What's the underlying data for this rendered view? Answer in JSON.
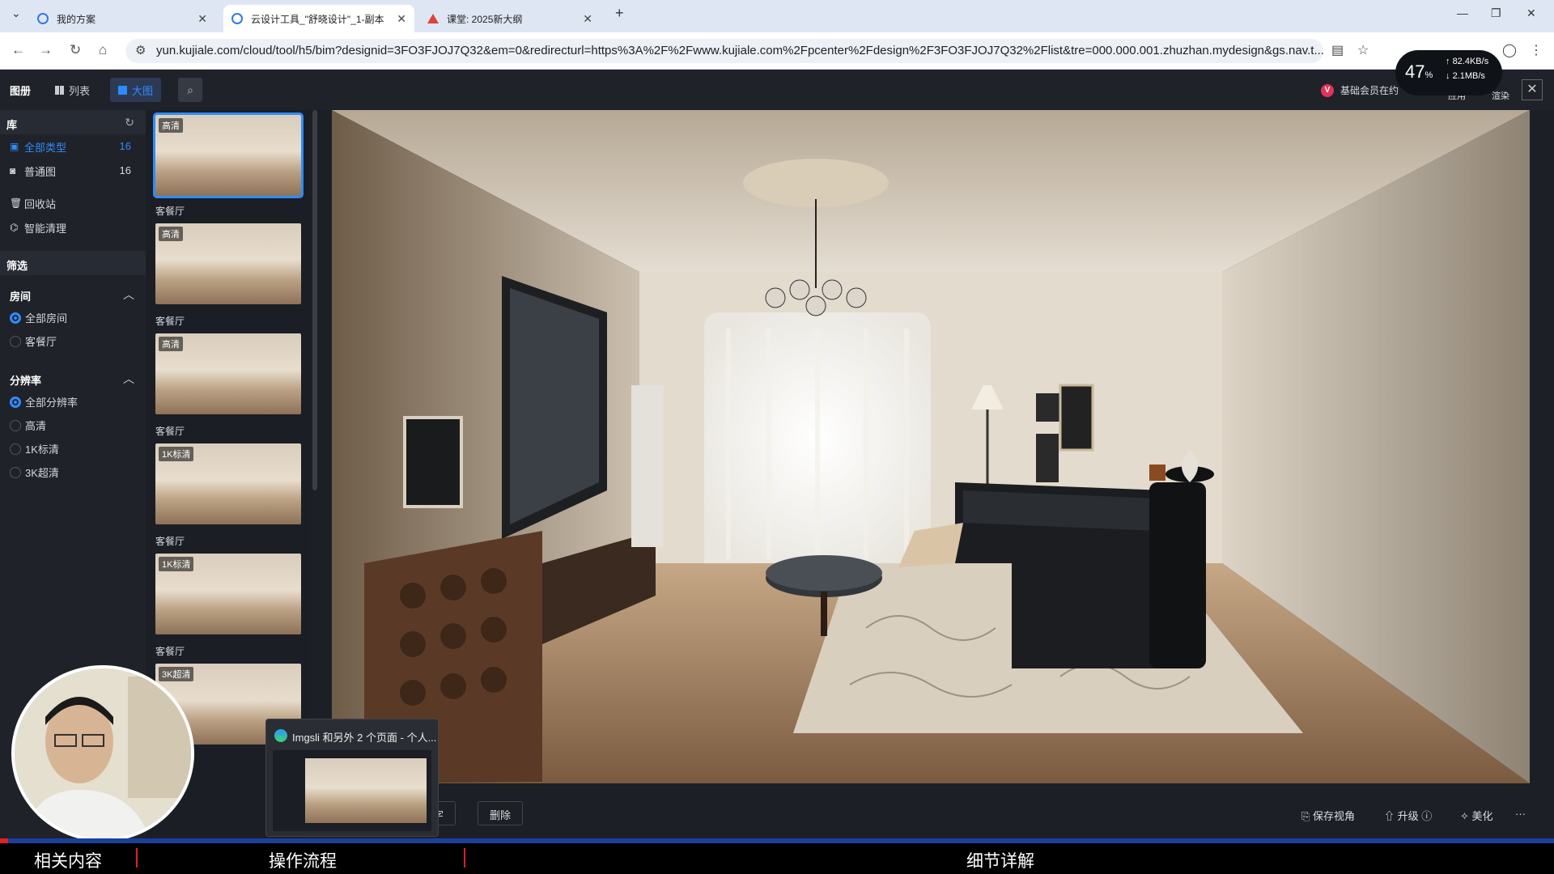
{
  "browser": {
    "tabs": [
      {
        "title": "我的方案",
        "active": false,
        "icon": "kujiale-icon"
      },
      {
        "title": "云设计工具_\"舒晓设计\"_1-副本",
        "active": true,
        "icon": "kujiale-icon"
      },
      {
        "title": "课堂: 2025新大纲",
        "active": false,
        "icon": "warning-icon"
      }
    ],
    "url": "yun.kujiale.com/cloud/tool/h5/bim?designid=3FO3FJOJ7Q32&em=0&redirecturl=https%3A%2F%2Fwww.kujiale.com%2Fpcenter%2Fdesign%2F3FO3FJOJ7Q32%2Flist&tre=000.000.001.zhuzhan.mydesign&gs.nav.t..."
  },
  "toolbar": {
    "title": "图册",
    "list_label": "列表",
    "large_label": "大图",
    "member_text": "基础会员在约",
    "apps_label": "应用",
    "render_label": "渲染"
  },
  "speed": {
    "percent": "47",
    "percent_unit": "%",
    "up": "82.4KB/s",
    "down": "2.1MB/s"
  },
  "sidebar": {
    "library_label": "库",
    "types": [
      {
        "label": "全部类型",
        "count": "16",
        "selected": true,
        "icon": "album-icon"
      },
      {
        "label": "普通图",
        "count": "16",
        "selected": false,
        "icon": "camera-icon"
      }
    ],
    "trash_label": "回收站",
    "smart_clean_label": "智能清理",
    "filter_label": "筛选",
    "room": {
      "title": "房间",
      "options": [
        "全部房间",
        "客餐厅"
      ],
      "selected_index": 0
    },
    "resolution": {
      "title": "分辨率",
      "options": [
        "全部分辨率",
        "高清",
        "1K标清",
        "3K超清"
      ],
      "selected_index": 0
    }
  },
  "thumbnails": [
    {
      "badge": "高清",
      "label": "客餐厅",
      "selected": true
    },
    {
      "badge": "高清",
      "label": "客餐厅",
      "selected": false
    },
    {
      "badge": "高清",
      "label": "客餐厅",
      "selected": false
    },
    {
      "badge": "1K标清",
      "label": "客餐厅",
      "selected": false
    },
    {
      "badge": "1K标清",
      "label": "客餐厅",
      "selected": false
    },
    {
      "badge": "3K超清",
      "label": "",
      "selected": false
    }
  ],
  "bottom": {
    "share_label": "字",
    "delete_label": "删除",
    "save_view_label": "保存视角",
    "upgrade_label": "升级",
    "beautify_label": "美化",
    "more_label": "···"
  },
  "popup": {
    "title": "Imgsli 和另外 2 个页面 - 个人..."
  },
  "captions": {
    "left": "相关内容",
    "middle": "操作流程",
    "right": "细节详解"
  },
  "progress_fraction": 0.005,
  "colors": {
    "accent": "#2f8cff",
    "caption_red": "#e0202a",
    "progress_blue": "#1c3f9c"
  }
}
